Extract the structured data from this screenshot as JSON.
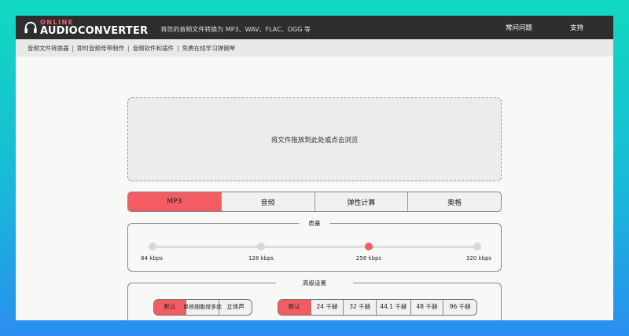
{
  "header": {
    "logo_online": "ONLINE",
    "logo_main": "AUDIOCONVERTER",
    "tagline": "将您的音频文件转换为 MP3、WAV、FLAC、OGG 等",
    "nav": {
      "faq": "常问问题",
      "support": "支持"
    }
  },
  "subnav": {
    "items": [
      "音频文件转换器",
      "即时音频母带制作",
      "音频软件和插件",
      "免费在线学习弹钢琴"
    ]
  },
  "dropzone": {
    "text": "将文件拖放到此处或点击浏览"
  },
  "formats": {
    "items": [
      "MP3",
      "音频",
      "弹性计算",
      "奥格"
    ],
    "active_index": 0
  },
  "quality": {
    "legend": "质量",
    "stops": [
      "64 kbps",
      "128 kbps",
      "256 kbps",
      "320 kbps"
    ],
    "selected_index": 2
  },
  "advanced": {
    "legend": "高级设置",
    "channels": {
      "items": [
        "默认",
        "单核细胞增多症",
        "立体声"
      ],
      "active_index": 0
    },
    "sample_rate": {
      "items": [
        "默认",
        "24 千赫",
        "32 千赫",
        "44.1 千赫",
        "48 千赫",
        "96 千赫"
      ],
      "active_index": 0
    }
  },
  "colors": {
    "accent": "#f25c62",
    "topbar": "#2e2e2e",
    "subnav": "#e9e9e7"
  }
}
